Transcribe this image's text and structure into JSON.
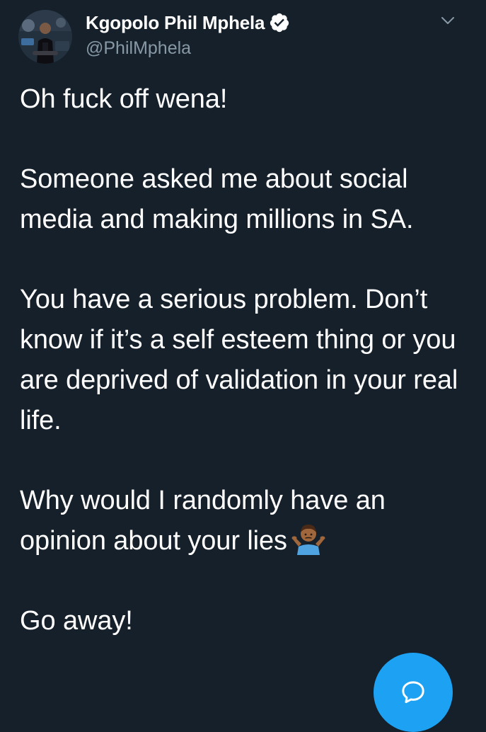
{
  "author": {
    "display_name": "Kgopolo Phil Mphela",
    "handle": "@PhilMphela",
    "verified": true,
    "avatar_icon": "profile-photo"
  },
  "tweet": {
    "paragraphs": [
      "Oh fuck off wena!",
      "Someone asked me about social media and making millions in SA.",
      "You have a serious problem. Don’t know if it’s a self esteem thing or you are deprived of validation in your real life.",
      "Why would I randomly have an opinion about your lies",
      "Go away!"
    ],
    "emoji": "person-shrugging-icon"
  },
  "controls": {
    "menu_icon": "chevron-down-icon",
    "compose_icon": "reply-bubble-icon"
  },
  "colors": {
    "background": "#15202b",
    "text_primary": "#ffffff",
    "text_secondary": "#8899a6",
    "accent": "#1da1f2"
  }
}
